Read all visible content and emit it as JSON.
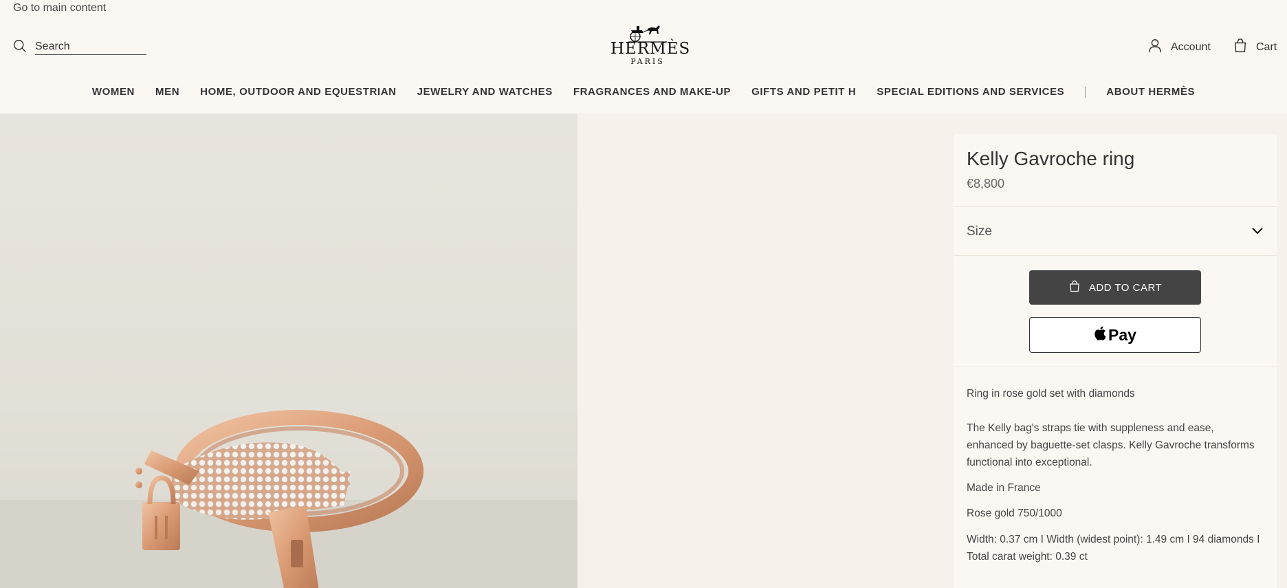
{
  "header": {
    "skip_link": "Go to main content",
    "search_placeholder": "Search",
    "logo_word": "HERMÈS",
    "logo_sub": "PARIS",
    "account_label": "Account",
    "cart_label": "Cart"
  },
  "nav": {
    "items": [
      "WOMEN",
      "MEN",
      "HOME, OUTDOOR AND EQUESTRIAN",
      "JEWELRY AND WATCHES",
      "FRAGRANCES AND MAKE-UP",
      "GIFTS AND PETIT H",
      "SPECIAL EDITIONS AND SERVICES",
      "ABOUT HERMÈS"
    ]
  },
  "product": {
    "title": "Kelly Gavroche ring",
    "price": "€8,800",
    "size_label": "Size",
    "add_to_cart_label": "ADD TO CART",
    "apple_pay_label": "Pay",
    "short_description": "Ring in rose gold set with diamonds",
    "long_description": "The Kelly bag's straps tie with suppleness and ease, enhanced by baguette-set clasps. Kelly Gavroche transforms functional into exceptional.",
    "origin": "Made in France",
    "material": "Rose gold 750/1000",
    "dimensions": "Width: 0.37 cm I Width (widest point): 1.49 cm I 94 diamonds I Total carat weight: 0.39 ct"
  },
  "icons": {
    "search": "search-icon",
    "account": "person-icon",
    "cart": "shopping-bag-icon",
    "size": "chevron-down-icon",
    "add_to_cart": "shopping-bag-icon",
    "apple_pay": "apple-icon"
  },
  "colors": {
    "header_bg": "#fbf8f3",
    "page_bg": "#f6f1ea",
    "primary_button": "#444444",
    "rose_gold": "#d99a73"
  }
}
